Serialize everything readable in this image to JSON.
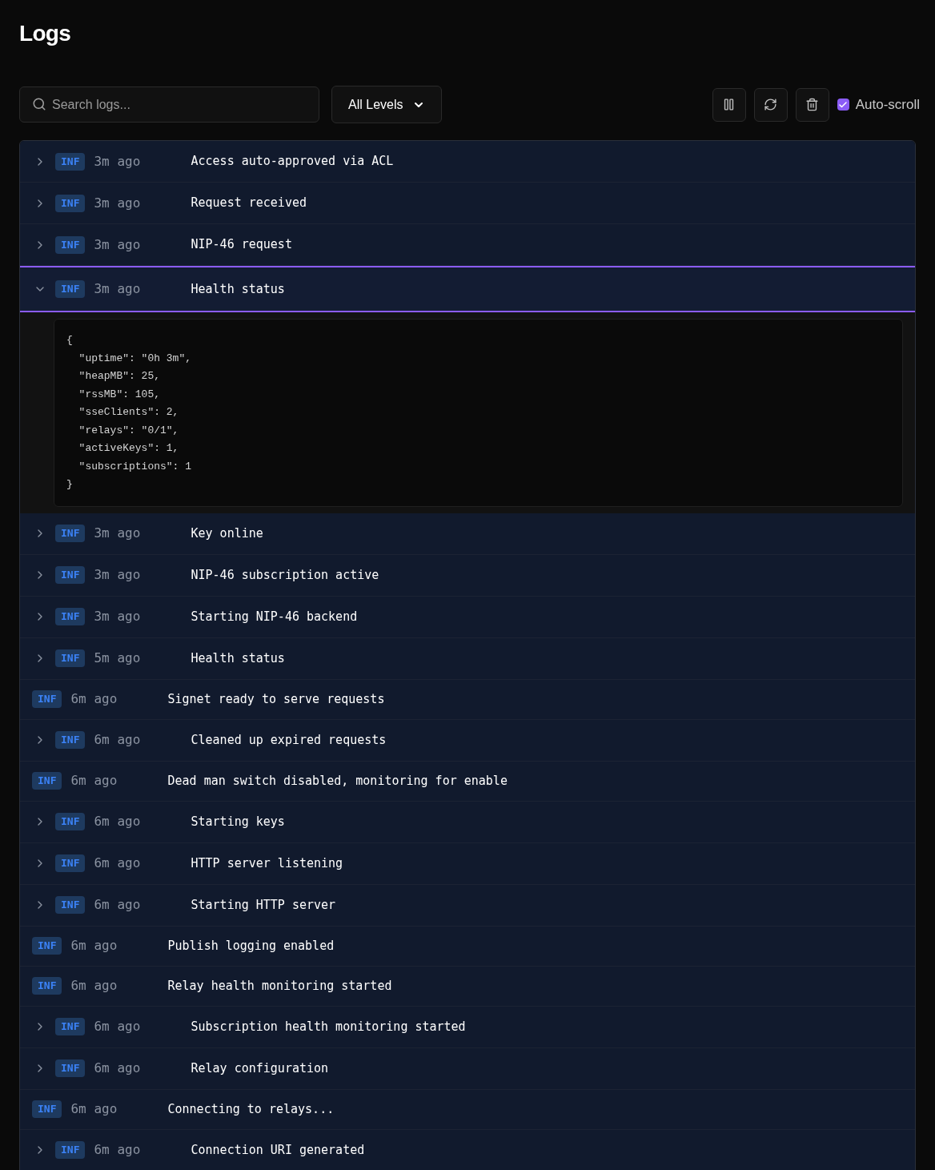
{
  "title": "Logs",
  "search": {
    "placeholder": "Search logs..."
  },
  "level_filter": {
    "value": "All Levels"
  },
  "toolbar": {
    "auto_scroll": {
      "label": "Auto-scroll",
      "checked": true
    }
  },
  "logs": [
    {
      "kind": "expandable",
      "expanded": false,
      "level": "INF",
      "time": "3m ago",
      "message": "Access auto-approved via ACL"
    },
    {
      "kind": "expandable",
      "expanded": false,
      "level": "INF",
      "time": "3m ago",
      "message": "Request received"
    },
    {
      "kind": "expandable",
      "expanded": false,
      "level": "INF",
      "time": "3m ago",
      "message": "NIP-46 request"
    },
    {
      "kind": "expandable",
      "expanded": true,
      "level": "INF",
      "time": "3m ago",
      "message": "Health status",
      "details": "{\n  \"uptime\": \"0h 3m\",\n  \"heapMB\": 25,\n  \"rssMB\": 105,\n  \"sseClients\": 2,\n  \"relays\": \"0/1\",\n  \"activeKeys\": 1,\n  \"subscriptions\": 1\n}"
    },
    {
      "kind": "expandable",
      "expanded": false,
      "level": "INF",
      "time": "3m ago",
      "message": "Key online"
    },
    {
      "kind": "expandable",
      "expanded": false,
      "level": "INF",
      "time": "3m ago",
      "message": "NIP-46 subscription active"
    },
    {
      "kind": "expandable",
      "expanded": false,
      "level": "INF",
      "time": "3m ago",
      "message": "Starting NIP-46 backend"
    },
    {
      "kind": "expandable",
      "expanded": false,
      "level": "INF",
      "time": "5m ago",
      "message": "Health status"
    },
    {
      "kind": "plain",
      "level": "INF",
      "time": "6m ago",
      "message": "Signet ready to serve requests"
    },
    {
      "kind": "expandable",
      "expanded": false,
      "level": "INF",
      "time": "6m ago",
      "message": "Cleaned up expired requests"
    },
    {
      "kind": "plain",
      "level": "INF",
      "time": "6m ago",
      "message": "Dead man switch disabled, monitoring for enable"
    },
    {
      "kind": "expandable",
      "expanded": false,
      "level": "INF",
      "time": "6m ago",
      "message": "Starting keys"
    },
    {
      "kind": "expandable",
      "expanded": false,
      "level": "INF",
      "time": "6m ago",
      "message": "HTTP server listening"
    },
    {
      "kind": "expandable",
      "expanded": false,
      "level": "INF",
      "time": "6m ago",
      "message": "Starting HTTP server"
    },
    {
      "kind": "plain",
      "level": "INF",
      "time": "6m ago",
      "message": "Publish logging enabled"
    },
    {
      "kind": "plain",
      "level": "INF",
      "time": "6m ago",
      "message": "Relay health monitoring started"
    },
    {
      "kind": "expandable",
      "expanded": false,
      "level": "INF",
      "time": "6m ago",
      "message": "Subscription health monitoring started"
    },
    {
      "kind": "expandable",
      "expanded": false,
      "level": "INF",
      "time": "6m ago",
      "message": "Relay configuration"
    },
    {
      "kind": "plain",
      "level": "INF",
      "time": "6m ago",
      "message": "Connecting to relays..."
    },
    {
      "kind": "expandable",
      "expanded": false,
      "level": "INF",
      "time": "6m ago",
      "message": "Connection URI generated"
    }
  ]
}
